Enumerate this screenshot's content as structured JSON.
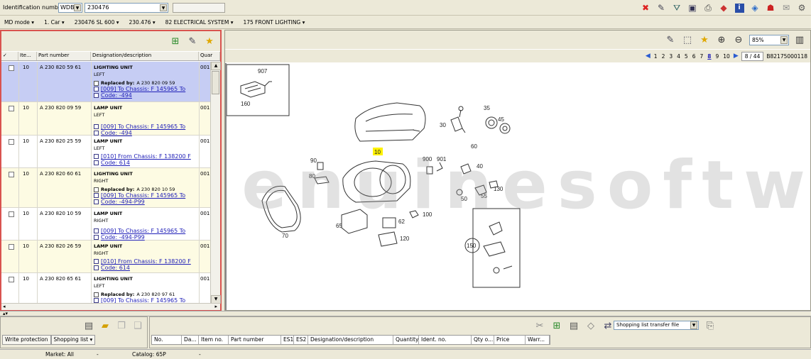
{
  "topbar": {
    "ident_label": "Identification number",
    "ident_type": "WDB",
    "ident_value": "230476",
    "icons": [
      "delete-red-x-icon",
      "edit-form-icon",
      "filter-icon",
      "window-icon",
      "print-icon",
      "eraser-icon",
      "info-icon",
      "book-icon",
      "transfer-tool-icon",
      "envelope-icon",
      "settings-gear-icon"
    ]
  },
  "breadcrumb": [
    "MD mode",
    "1. Car",
    "230476 SL 600",
    "230.476",
    "82 ELECTRICAL SYSTEM",
    "175 FRONT LIGHTING"
  ],
  "left": {
    "headers": [
      "✓",
      "Ite...",
      "Part number",
      "Designation/description",
      "Quar"
    ],
    "rows": [
      {
        "item": "10",
        "part": "A 230 820 59 61",
        "title": "LIGHTING UNIT",
        "sub": "LEFT",
        "replaced_label": "Replaced by:",
        "replaced": "A 230 820 09 59",
        "link1": "[009] To Chassis: F 145965 To",
        "link2": "Code: -494",
        "qty": "001",
        "style": "sel"
      },
      {
        "item": "10",
        "part": "A 230 820 09 59",
        "title": "LAMP UNIT",
        "sub": "LEFT",
        "replaced_label": "",
        "replaced": "",
        "link1": "[009] To Chassis: F 145965 To",
        "link2": "Code: -494",
        "qty": "001",
        "style": "alt"
      },
      {
        "item": "10",
        "part": "A 230 820 25 59",
        "title": "LAMP UNIT",
        "sub": "LEFT",
        "replaced_label": "",
        "replaced": "",
        "link1": "[010] From Chassis: F 138200 F",
        "link2": "Code: 614",
        "qty": "001",
        "style": ""
      },
      {
        "item": "10",
        "part": "A 230 820 60 61",
        "title": "LIGHTING UNIT",
        "sub": "RIGHT",
        "replaced_label": "Replaced by:",
        "replaced": "A 230 820 10 59",
        "link1": "[009] To Chassis: F 145965 To",
        "link2": "Code: -494-P99",
        "qty": "001",
        "style": "alt"
      },
      {
        "item": "10",
        "part": "A 230 820 10 59",
        "title": "LAMP UNIT",
        "sub": "RIGHT",
        "replaced_label": "",
        "replaced": "",
        "link1": "[009] To Chassis: F 145965 To",
        "link2": "Code: -494-P99",
        "qty": "001",
        "style": ""
      },
      {
        "item": "10",
        "part": "A 230 820 26 59",
        "title": "LAMP UNIT",
        "sub": "RIGHT",
        "replaced_label": "",
        "replaced": "",
        "link1": "[010] From Chassis: F 138200 F",
        "link2": "Code: 614",
        "qty": "001",
        "style": "alt"
      },
      {
        "item": "10",
        "part": "A 230 820 65 61",
        "title": "LIGHTING UNIT",
        "sub": "LEFT",
        "replaced_label": "Replaced by:",
        "replaced": "A 230 820 97 61",
        "link1": "[009] To Chassis: F 145965 To",
        "link2": "",
        "qty": "001",
        "style": ""
      }
    ]
  },
  "right": {
    "zoom": "85%",
    "pages": [
      "1",
      "2",
      "3",
      "4",
      "5",
      "6",
      "7",
      "8",
      "9",
      "10"
    ],
    "current_page": "8",
    "page_of": "8 / 44",
    "doc_id": "B82175000118",
    "watermark": "genuinesoftware.co",
    "callouts": [
      "907",
      "160",
      "35",
      "45",
      "30",
      "60",
      "10",
      "90",
      "80",
      "900",
      "901",
      "40",
      "130",
      "55",
      "50",
      "100",
      "65",
      "62",
      "120",
      "70",
      "150"
    ]
  },
  "bottom_left": {
    "tabs": [
      "Write protection",
      "Shopping list"
    ]
  },
  "bottom_right": {
    "transfer_option": "Shopping list transfer file",
    "columns": [
      "No.",
      "Da...",
      "Item no.",
      "Part number",
      "ES1",
      "ES2",
      "Designation/description",
      "Quantity",
      "Ident. no.",
      "Qty o...",
      "Price",
      "Warr..."
    ]
  },
  "status": {
    "market": "Market: All",
    "sep1": "-",
    "catalog": "Catalog: 65P",
    "sep2": "-"
  }
}
